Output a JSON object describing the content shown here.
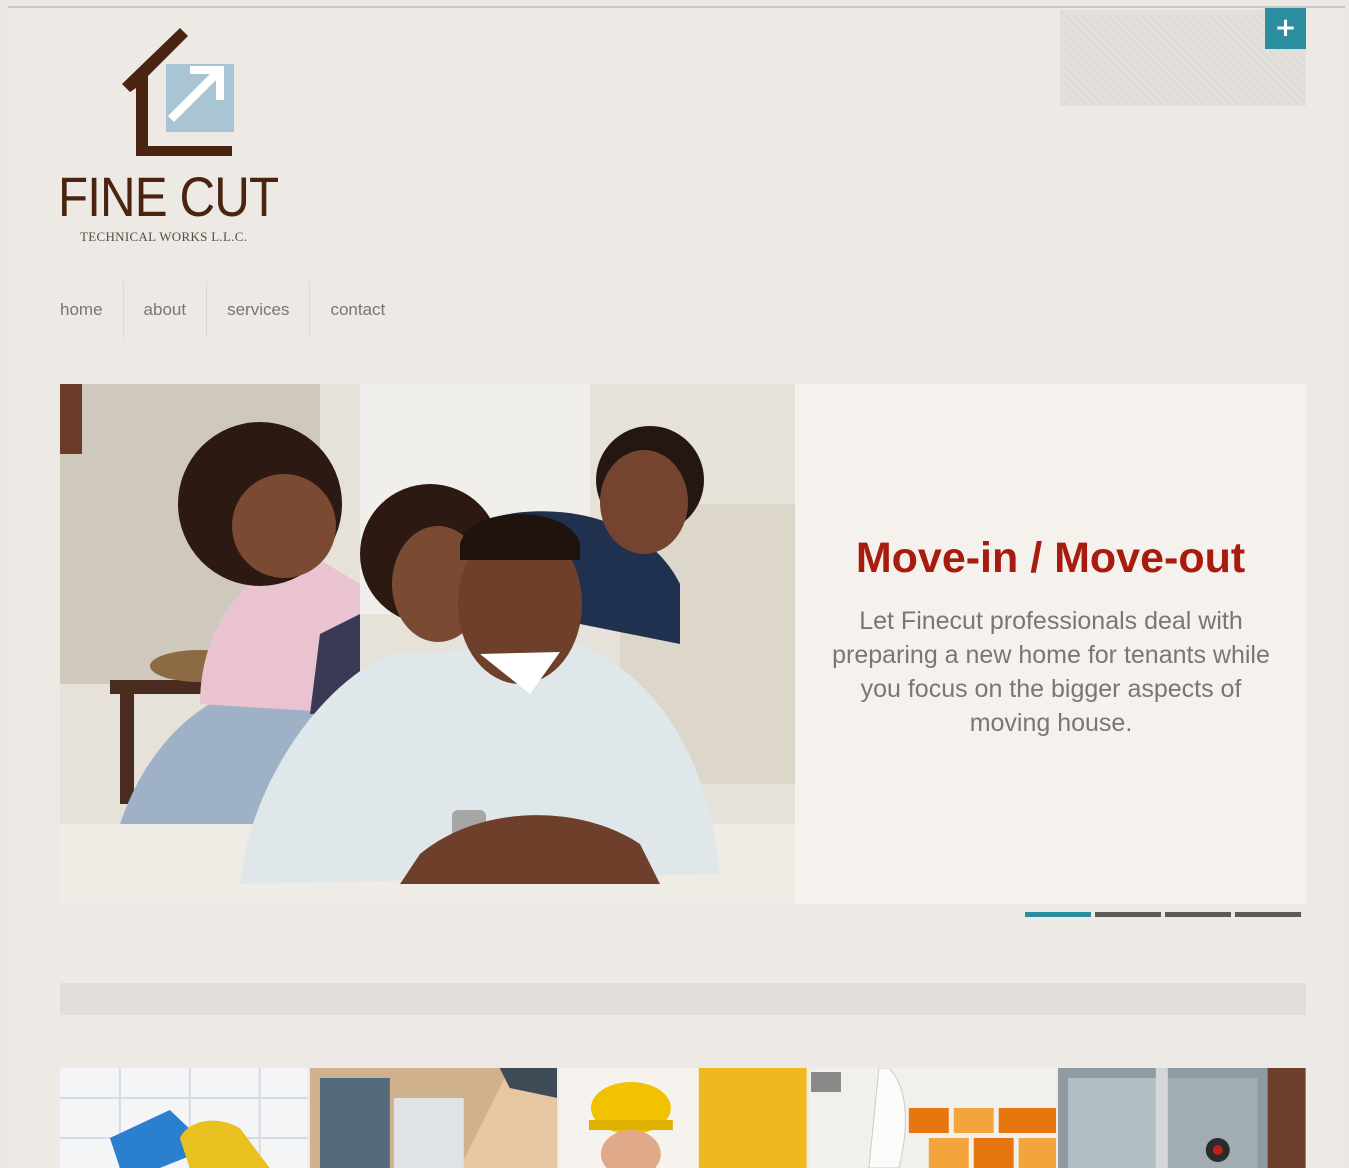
{
  "header": {
    "plus_label": "+",
    "logo": {
      "name": "FINE CUT",
      "subtitle": "TECHNICAL WORKS L.L.C."
    }
  },
  "nav": {
    "items": [
      {
        "label": "home"
      },
      {
        "label": "about"
      },
      {
        "label": "services"
      },
      {
        "label": "contact"
      }
    ]
  },
  "slider": {
    "title": "Move-in / Move-out",
    "body": "Let Finecut professionals deal with preparing a new home for tenants while you focus on the bigger aspects of moving house.",
    "slide_count": 4,
    "active_index": 0
  },
  "colors": {
    "accent": "#2b8ea0",
    "title_red": "#a81c0f",
    "logo_brown": "#4a2410",
    "logo_blue": "#a9c5d3"
  },
  "thumbnails": [
    {
      "name": "cleaning-thumb"
    },
    {
      "name": "building-ac-thumb"
    },
    {
      "name": "worker-thumb"
    },
    {
      "name": "tiles-thumb"
    },
    {
      "name": "window-thumb"
    }
  ]
}
